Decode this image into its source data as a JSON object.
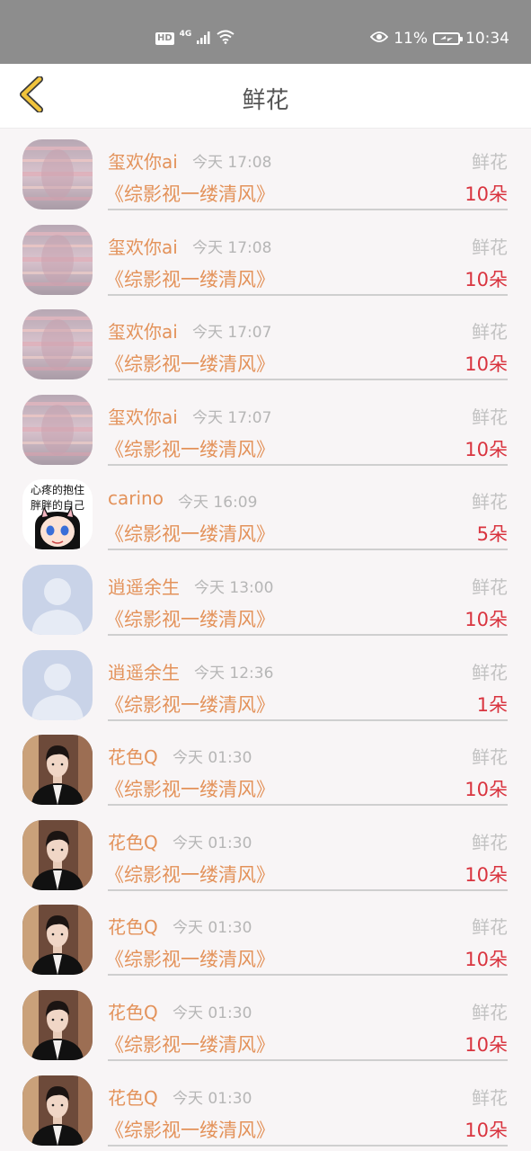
{
  "status_bar": {
    "hd": "HD",
    "network": "4G",
    "battery_percent": "11%",
    "time": "10:34",
    "icons": [
      "hd-icon",
      "signal-icon",
      "wifi-icon",
      "eye-icon",
      "battery-charging-icon"
    ]
  },
  "header": {
    "title": "鲜花",
    "back_icon": "chevron-left-icon",
    "back_color": "#f0c33c"
  },
  "colors": {
    "name": "#e3925a",
    "count": "#d9343f",
    "muted": "#b6b6b6"
  },
  "records": [
    {
      "user": "玺欢你ai",
      "time": "今天 17:08",
      "gift": "鲜花",
      "book": "《综影视一缕清风》",
      "count": "10朵",
      "avatar": "blurred-photo"
    },
    {
      "user": "玺欢你ai",
      "time": "今天 17:08",
      "gift": "鲜花",
      "book": "《综影视一缕清风》",
      "count": "10朵",
      "avatar": "blurred-photo"
    },
    {
      "user": "玺欢你ai",
      "time": "今天 17:07",
      "gift": "鲜花",
      "book": "《综影视一缕清风》",
      "count": "10朵",
      "avatar": "blurred-photo"
    },
    {
      "user": "玺欢你ai",
      "time": "今天 17:07",
      "gift": "鲜花",
      "book": "《综影视一缕清风》",
      "count": "10朵",
      "avatar": "blurred-photo"
    },
    {
      "user": "carino",
      "time": "今天 16:09",
      "gift": "鲜花",
      "book": "《综影视一缕清风》",
      "count": "5朵",
      "avatar": "cartoon-girl",
      "avatar_text": [
        "心疼的抱住",
        "胖胖的自己"
      ]
    },
    {
      "user": "逍遥余生",
      "time": "今天 13:00",
      "gift": "鲜花",
      "book": "《综影视一缕清风》",
      "count": "10朵",
      "avatar": "default-person"
    },
    {
      "user": "逍遥余生",
      "time": "今天 12:36",
      "gift": "鲜花",
      "book": "《综影视一缕清风》",
      "count": "1朵",
      "avatar": "default-person"
    },
    {
      "user": "花色Q",
      "time": "今天 01:30",
      "gift": "鲜花",
      "book": "《综影视一缕清风》",
      "count": "10朵",
      "avatar": "man-in-suit"
    },
    {
      "user": "花色Q",
      "time": "今天 01:30",
      "gift": "鲜花",
      "book": "《综影视一缕清风》",
      "count": "10朵",
      "avatar": "man-in-suit"
    },
    {
      "user": "花色Q",
      "time": "今天 01:30",
      "gift": "鲜花",
      "book": "《综影视一缕清风》",
      "count": "10朵",
      "avatar": "man-in-suit"
    },
    {
      "user": "花色Q",
      "time": "今天 01:30",
      "gift": "鲜花",
      "book": "《综影视一缕清风》",
      "count": "10朵",
      "avatar": "man-in-suit"
    },
    {
      "user": "花色Q",
      "time": "今天 01:30",
      "gift": "鲜花",
      "book": "《综影视一缕清风》",
      "count": "10朵",
      "avatar": "man-in-suit"
    }
  ]
}
